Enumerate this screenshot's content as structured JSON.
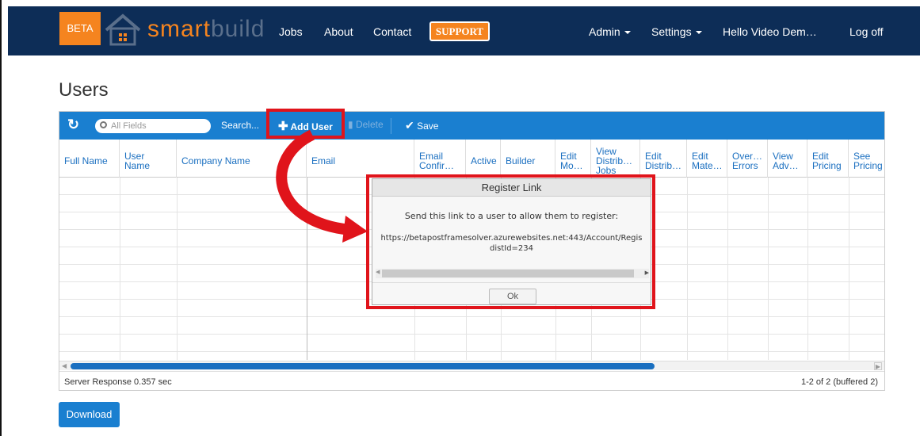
{
  "navbar": {
    "beta_label": "BETA",
    "logo_text_a": "smart",
    "logo_text_b": "build",
    "links": {
      "jobs": "Jobs",
      "about": "About",
      "contact": "Contact",
      "support": "SUPPORT",
      "admin": "Admin",
      "settings": "Settings",
      "user": "Hello Video Dem…",
      "logoff": "Log off"
    },
    "colors": {
      "bar": "#0d2d57",
      "accent": "#f5841f"
    }
  },
  "page": {
    "title": "Users"
  },
  "toolbar": {
    "refresh_icon": "refresh-icon",
    "search_placeholder": "All Fields",
    "search_button": "Search...",
    "add_user": "Add User",
    "delete": "Delete",
    "save": "Save",
    "color": "#1a7fd0"
  },
  "columns": [
    {
      "label": "Full Name"
    },
    {
      "label": "User Name"
    },
    {
      "label": "Company Name"
    },
    {
      "label": "Email"
    },
    {
      "label": "Email Confir…"
    },
    {
      "label": "Active"
    },
    {
      "label": "Builder"
    },
    {
      "label": "Edit Mo…"
    },
    {
      "label": "View Distrib… Jobs"
    },
    {
      "label": "Edit Distrib…"
    },
    {
      "label": "Edit Mate…"
    },
    {
      "label": "Over… Errors"
    },
    {
      "label": "View Adv…"
    },
    {
      "label": "Edit Pricing"
    },
    {
      "label": "See Pricing"
    }
  ],
  "footer": {
    "left": "Server Response 0.357 sec",
    "right": "1-2 of 2 (buffered 2)"
  },
  "download": "Download",
  "dialog": {
    "title": "Register Link",
    "message": "Send this link to a user to allow them to register:",
    "link_line1": "https://betapostframesolver.azurewebsites.net:443/Account/Regis",
    "link_line2": "distId=234",
    "ok": "Ok"
  },
  "highlight_color": "#e0141b"
}
